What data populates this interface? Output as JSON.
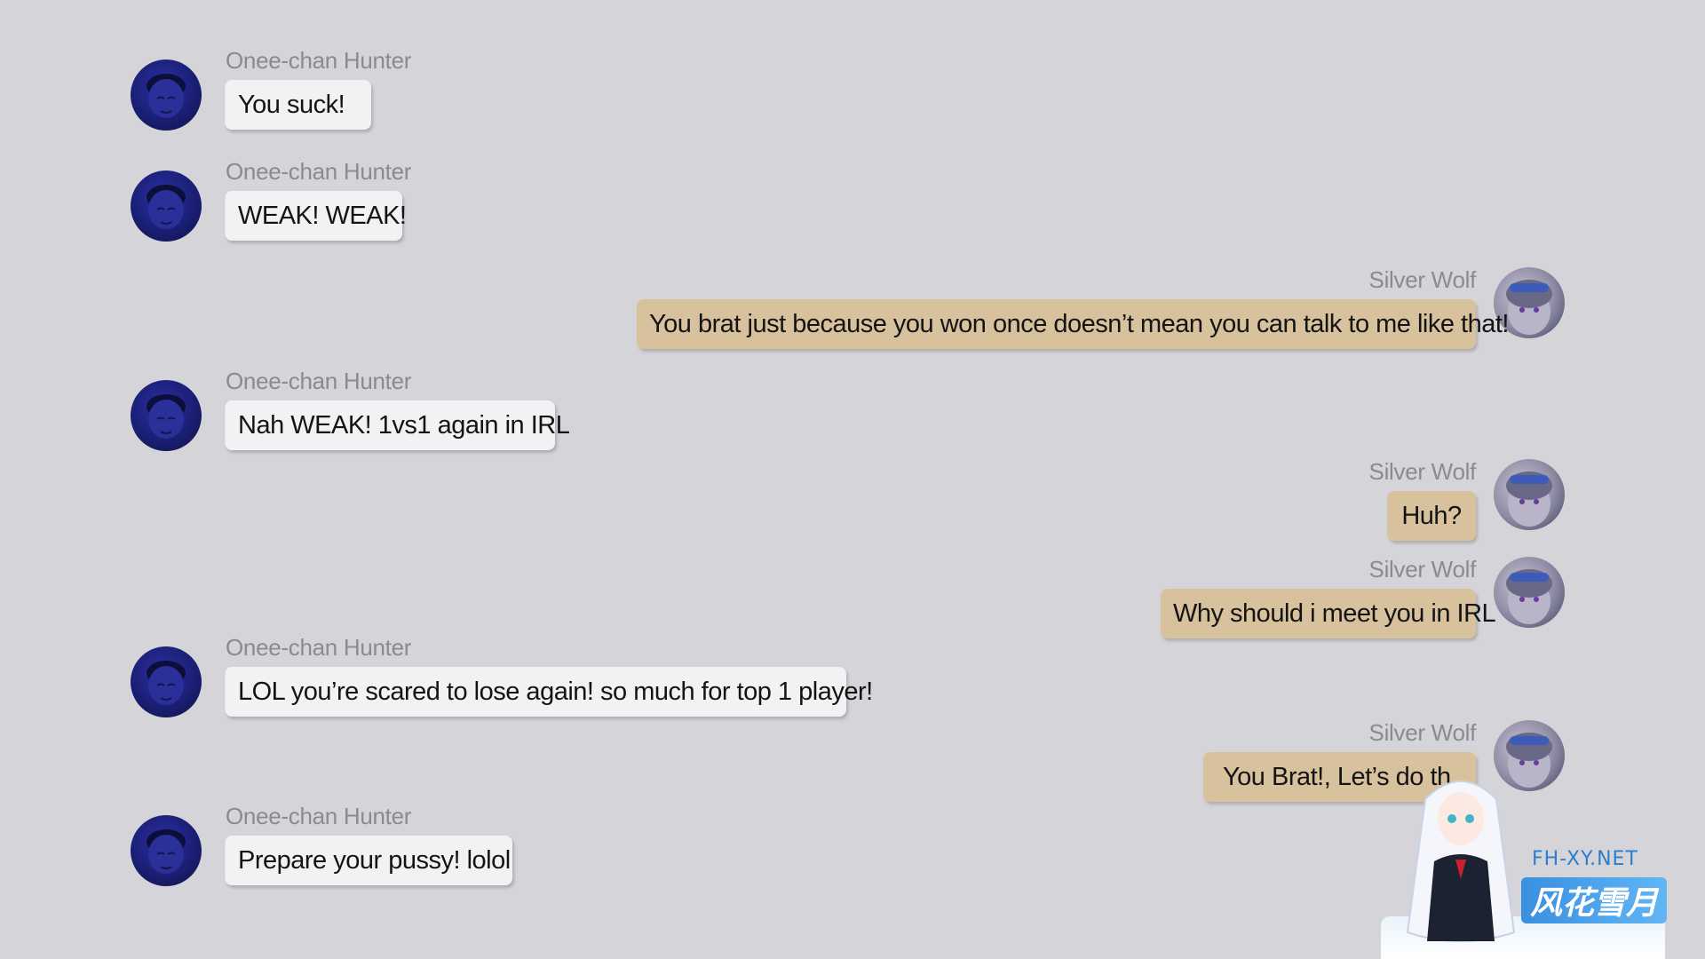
{
  "colors": {
    "background": "#d5d5d9",
    "incoming_bubble": "#f2f2f4",
    "outgoing_bubble": "#d8c29d",
    "name_text": "#8a8a8f"
  },
  "messages": [
    {
      "sender": "Onee-chan Hunter",
      "side": "left",
      "avatar": "avatar-hunter-icon",
      "text": "You suck!"
    },
    {
      "sender": "Onee-chan Hunter",
      "side": "left",
      "avatar": "avatar-hunter-icon",
      "text": "WEAK! WEAK!"
    },
    {
      "sender": "Silver Wolf",
      "side": "right",
      "avatar": "avatar-silver-wolf-icon",
      "text": "You brat just because you won once doesn’t mean you can talk to me like that!"
    },
    {
      "sender": "Onee-chan Hunter",
      "side": "left",
      "avatar": "avatar-hunter-icon",
      "text": "Nah WEAK! 1vs1 again in IRL"
    },
    {
      "sender": "Silver Wolf",
      "side": "right",
      "avatar": "avatar-silver-wolf-icon",
      "text": "Huh?"
    },
    {
      "sender": "Silver Wolf",
      "side": "right",
      "avatar": "avatar-silver-wolf-icon",
      "text": "Why should i meet you in IRL"
    },
    {
      "sender": "Onee-chan Hunter",
      "side": "left",
      "avatar": "avatar-hunter-icon",
      "text": "LOL you’re scared to lose again! so much for top 1 player!"
    },
    {
      "sender": "Silver Wolf",
      "side": "right",
      "avatar": "avatar-silver-wolf-icon",
      "text": "You Brat!, Let’s do th"
    },
    {
      "sender": "Onee-chan Hunter",
      "side": "left",
      "avatar": "avatar-hunter-icon",
      "text": "Prepare your pussy! lolol"
    }
  ],
  "watermark": {
    "url": "FH-XY.NET",
    "brand": "风花雪月"
  }
}
